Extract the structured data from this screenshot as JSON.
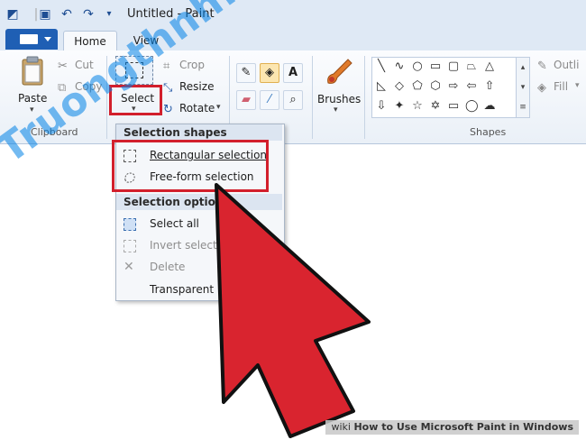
{
  "window": {
    "title": "Untitled - Paint",
    "quick_access": [
      "paint-app-icon",
      "save-icon",
      "undo-icon",
      "redo-icon",
      "customize-dropdown-icon"
    ]
  },
  "tabs": {
    "home": "Home",
    "view": "View"
  },
  "clipboard": {
    "paste": "Paste",
    "cut": "Cut",
    "copy": "Copy",
    "label": "Clipboard"
  },
  "image": {
    "select": "Select",
    "crop": "Crop",
    "resize": "Resize",
    "rotate": "Rotate"
  },
  "tools": {
    "brushes": "Brushes"
  },
  "shapes": {
    "label": "Shapes",
    "outline": "Outli",
    "fill": "Fill"
  },
  "select_menu": {
    "heading_shapes": "Selection shapes",
    "rectangular": "Rectangular selection",
    "freeform": "Free-form selection",
    "heading_options": "Selection options",
    "select_all": "Select all",
    "invert": "Invert selecti",
    "delete": "Delete",
    "transparent": "Transparent"
  },
  "watermark": "Truongthnh.top",
  "footer": {
    "prefix": "wiki",
    "text": "How to Use Microsoft Paint in Windows"
  },
  "colors": {
    "highlight": "#d21f2c",
    "arrow": "#d9242f",
    "file_tab": "#1f5fb4"
  }
}
